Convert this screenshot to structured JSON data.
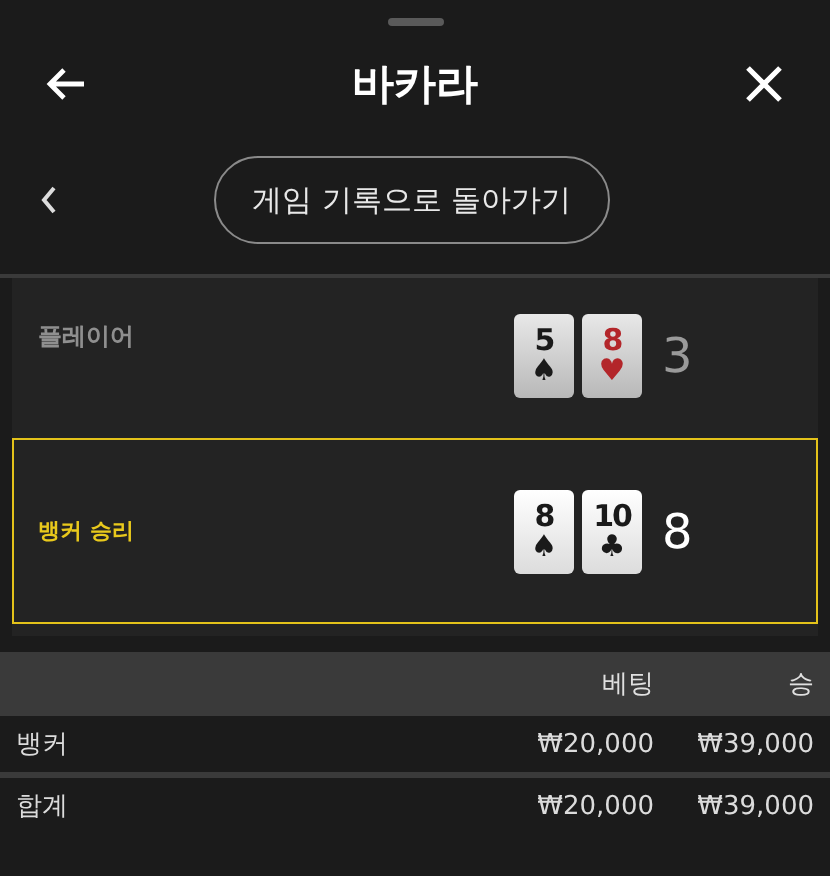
{
  "sheet": {
    "title": "바카라"
  },
  "back_to_history": {
    "label": "게임 기록으로 돌아가기"
  },
  "hands": [
    {
      "label": "플레이어",
      "winner": false,
      "score": "3",
      "cards": [
        {
          "rank": "5",
          "suit": "♠",
          "color": "#1a1a1a"
        },
        {
          "rank": "8",
          "suit": "♥",
          "color": "#b3262a"
        }
      ]
    },
    {
      "label": "뱅커 승리",
      "winner": true,
      "score": "8",
      "cards": [
        {
          "rank": "8",
          "suit": "♠",
          "color": "#1a1a1a"
        },
        {
          "rank": "10",
          "suit": "♣",
          "color": "#1a1a1a"
        }
      ]
    }
  ],
  "bets_table": {
    "columns": [
      "베팅",
      "승"
    ],
    "rows": [
      {
        "name": "뱅커",
        "bet": "₩20,000",
        "win": "₩39,000"
      },
      {
        "name": "합계",
        "bet": "₩20,000",
        "win": "₩39,000"
      }
    ]
  }
}
